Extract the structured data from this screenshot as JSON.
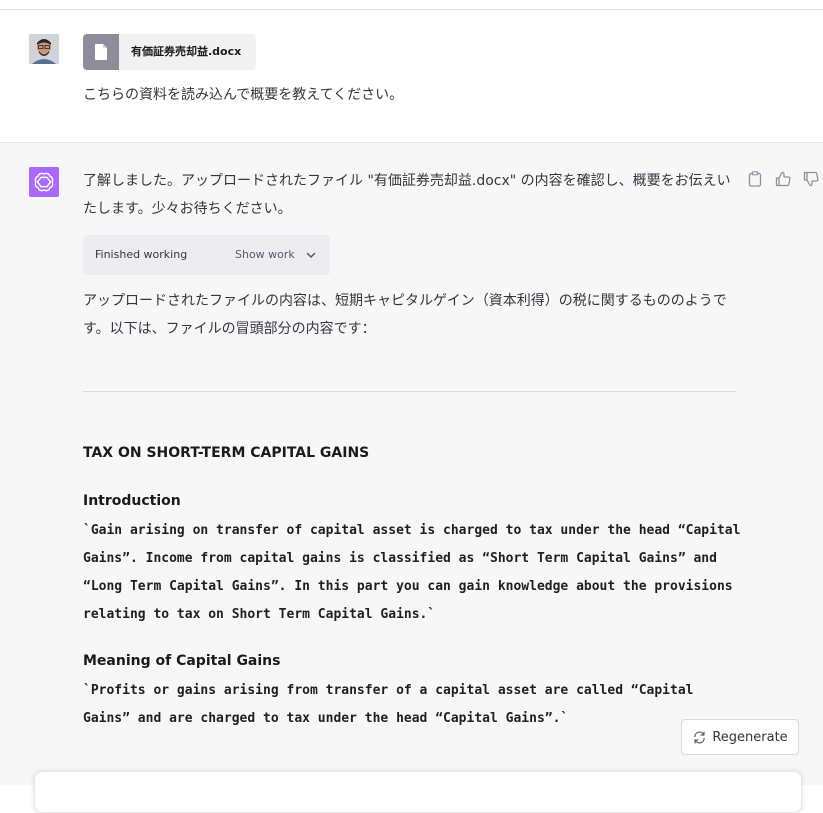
{
  "user_message": {
    "file_name": "有価証券売却益.docx",
    "text": "こちらの資料を読み込んで概要を教えてください。"
  },
  "assistant_message": {
    "intro": "了解しました。アップロードされたファイル \"有価証券売却益.docx\" の内容を確認し、概要をお伝えいたします。少々お待ちください。",
    "work_status": "Finished working",
    "show_work_label": "Show work",
    "summary": "アップロードされたファイルの内容は、短期キャピタルゲイン（資本利得）の税に関するもののようです。以下は、ファイルの冒頭部分の内容です：",
    "doc_title": "TAX ON SHORT-TERM CAPITAL GAINS",
    "intro_heading": "Introduction",
    "intro_code": "`Gain arising on transfer of capital asset is charged to tax under the head “Capital Gains”. Income from capital gains is classified as “Short Term Capital Gains” and “Long Term Capital Gains”. In this part you can gain knowledge about the provisions relating to tax on Short Term Capital Gains.`",
    "meaning_heading": "Meaning of Capital Gains",
    "meaning_code": "`Profits or gains arising from transfer of a capital asset are called “Capital Gains” and are charged to tax under the head “Capital Gains”.`"
  },
  "regenerate_label": "Regenerate",
  "icons": {
    "file": "file-icon",
    "copy": "clipboard-icon",
    "thumbs_up": "thumbs-up-icon",
    "thumbs_down": "thumbs-down-icon",
    "chevron": "chevron-down-icon",
    "regenerate": "refresh-icon"
  },
  "colors": {
    "assistant_avatar": "#ab68ff",
    "file_icon_bg": "#8d8c9b",
    "assistant_bg": "#f7f7f8"
  }
}
